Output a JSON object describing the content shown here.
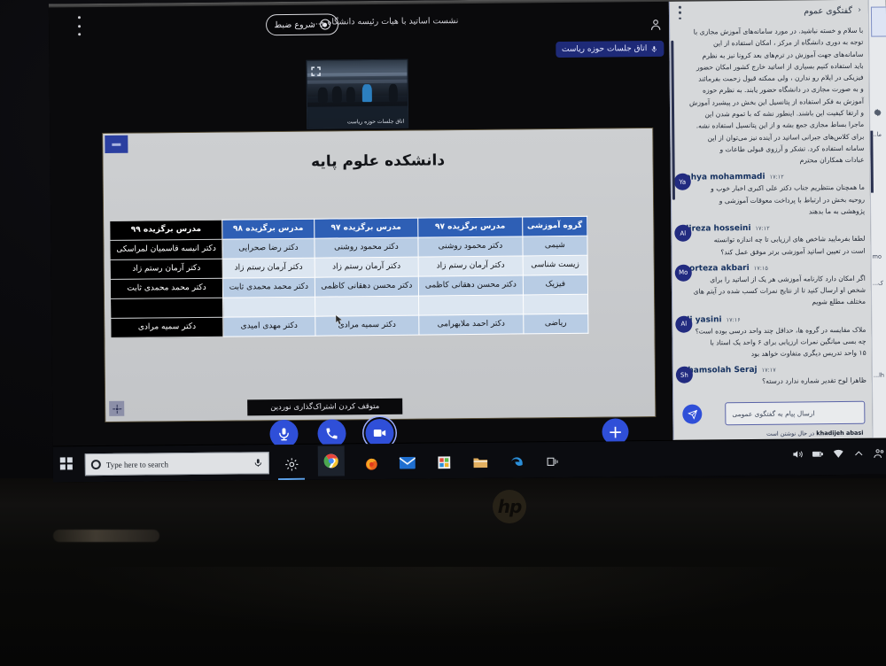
{
  "meeting": {
    "title": "نشست اساتید با هیات رئیسه دانشگاه و...",
    "record_button": "شروع ضبط",
    "room_badge": "اتاق جلسات حوزه ریاست",
    "video_thumb_label": "اتاق جلسات حوزه ریاست",
    "share_tooltip": "متوقف کردن اشتراک‌گذاری نوردین",
    "controls": [
      {
        "name": "camera-button",
        "icon": "camera-icon",
        "active": true
      },
      {
        "name": "hangup-button",
        "icon": "phone-icon",
        "active": false
      },
      {
        "name": "microphone-button",
        "icon": "microphone-icon",
        "active": false
      }
    ],
    "add_button": "+",
    "accent_color": "#2f4fd8"
  },
  "slide": {
    "title": "دانشکده علوم پایه",
    "headers": [
      "گروه آموزشی",
      "مدرس برگزیده ۹۷",
      "مدرس برگزیده ۹۷",
      "مدرس برگزیده ۹۸",
      "مدرس برگزیده ۹۹"
    ],
    "rows": [
      [
        "شیمی",
        "دکتر محمود روشنی",
        "دکتر محمود روشنی",
        "دکتر رضا صحرایی",
        "دکتر انیسه قاسمیان لمراسکی"
      ],
      [
        "زیست شناسی",
        "دکتر آرمان رستم زاد",
        "دکتر آرمان رستم زاد",
        "دکتر آرمان رستم زاد",
        "دکتر آرمان رستم زاد"
      ],
      [
        "فیزیک",
        "دکتر محسن دهقانی کاظمی",
        "دکتر محسن دهقانی کاظمی",
        "دکتر محمد محمدی ثابت",
        "دکتر محمد محمدی ثابت"
      ],
      [
        "",
        "",
        "",
        "",
        ""
      ],
      [
        "ریاضی",
        "دکتر احمد ملابهرامی",
        "دکتر سمیه مرادی",
        "دکتر مهدی امیدی",
        "دکتر سمیه مرادی"
      ]
    ],
    "header_color": "#2e5fb5",
    "row_color_odd": "#b8cce4",
    "row_color_even": "#dce6f1",
    "highlight_column_color": "#000000"
  },
  "chat": {
    "header_title": "گفتگوی عموم",
    "back_icon": "chevron-right-icon",
    "menu_icon": "kebab-menu-icon",
    "input_placeholder": "ارسال پیام به گفتگوی عمومی",
    "typing_user": "khadijeh abasi",
    "typing_suffix": "در حال نوشتن است",
    "send_icon": "send-icon",
    "messages": [
      {
        "name": "",
        "time": "",
        "initials": "",
        "text": "با سلام و خسته نباشید. در مورد سامانه‌های آموزش مجازی با\nتوجه به دوری دانشگاه از مرکز ، امکان استفاده از این\nسامانه‌های جهت آموزش در ترم‌های بعد کرونا نیز به نظرم\nباید استفاده کنیم بسیاری از اساتید خارج کشور امکان حضور\nفیزیکی در ایلام رو ندارن ، ولی ممکنه قبول زحمت بفرمائند\nو به صورت مجازی در دانشگاه حضور یابند. به نظرم حوزه\nآموزش به فکر استفاده از پتانسیل این بخش در پیشبرد آموزش\nو ارتقا کیفیت این باشند. اینطور نشه که با تموم شدن این\nماجرا بساط مجازی جمع بشه و از این پتانسیل استفاده نشه.\nبرای کلاس‌های جبرانی اساتید در آینده نیز می‌توان از این\nسامانه استفاده کرد. تشکر و آرزوی قبولی طاعات و\nعبادات همکاران محترم"
      },
      {
        "name": "yahya mohammadi",
        "time": "۱۷:۱۲",
        "initials": "Ya",
        "text": "ما همچنان منتظریم جناب دکتر علی اکبری اخبار خوب و\nروحیه بخش در ارتباط با پرداخت معوقات آموزشی و\nپژوهشی به ما بدهند"
      },
      {
        "name": "alireza hosseini",
        "time": "۱۷:۱۲",
        "initials": "Al",
        "text": "لطفا بفرمایید شاخص های ارزیابی تا چه اندازه توانسته\nاست در تعیین اساتید آموزشی برتر موفق عمل کند؟"
      },
      {
        "name": "morteza akbari",
        "time": "۱۷:۱۵",
        "initials": "Mo",
        "text": "اگر امکان دارد کارنامه آموزشی هر یک از اساتید را برای\nشخص او ارسال کنید تا از نتایج نمرات کسب شده در آیتم های\nمختلف مطلع شویم"
      },
      {
        "name": "ali yasini",
        "time": "۱۷:۱۶",
        "initials": "Al",
        "text": "ملاک مقایسه در گروه ها، حداقل چند واحد درسی بوده است؟\nچه بسی میانگین نمرات ارزیابی برای ۶ واحد یک استاد با\n۱۵ واحد تدریس دیگری متفاوت خواهد بود"
      },
      {
        "name": "Shamsolah Seraj",
        "time": "۱۷:۱۷",
        "initials": "Sh",
        "text": "ظاهرا لوح تقدیر شماره ندارد درسته؟"
      }
    ],
    "avatar_color": "#222b80"
  },
  "background_app": {
    "gear_icon": "gear-icon",
    "fragments": [
      "ما...",
      "mo",
      "ک...",
      "lh..."
    ]
  },
  "taskbar": {
    "start_icon": "windows-logo-icon",
    "search_placeholder": "Type here to search",
    "search_icon": "search-circle-icon",
    "mic_icon": "microphone-icon",
    "items": [
      {
        "name": "task-view",
        "icon": "task-view-icon"
      },
      {
        "name": "edge",
        "icon": "edge-icon"
      },
      {
        "name": "file-explorer",
        "icon": "folder-icon"
      },
      {
        "name": "microsoft-store",
        "icon": "store-icon"
      },
      {
        "name": "mail",
        "icon": "mail-icon"
      },
      {
        "name": "firefox",
        "icon": "firefox-icon"
      },
      {
        "name": "chrome",
        "icon": "chrome-icon"
      },
      {
        "name": "settings",
        "icon": "gear-icon"
      }
    ],
    "tray": [
      "people-icon",
      "chevron-up-icon",
      "wifi-icon",
      "battery-icon",
      "volume-icon"
    ]
  },
  "hardware": {
    "brand": "hp"
  }
}
